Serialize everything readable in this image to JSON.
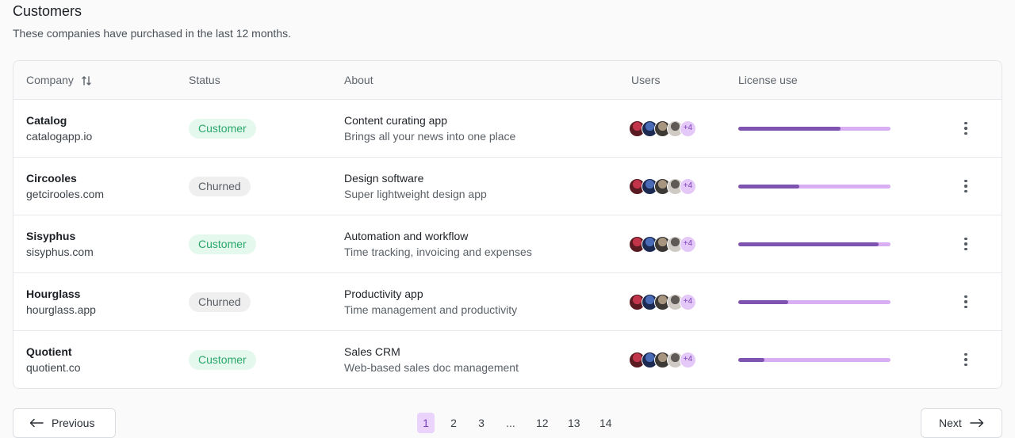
{
  "header": {
    "title": "Customers",
    "subtitle": "These companies have purchased in the last 12 months."
  },
  "table": {
    "columns": {
      "company": "Company",
      "status": "Status",
      "about": "About",
      "users": "Users",
      "license": "License use"
    },
    "rows": [
      {
        "name": "Catalog",
        "domain": "catalogapp.io",
        "status": "Customer",
        "status_type": "customer",
        "about_title": "Content curating app",
        "about_desc": "Brings all your news into one place",
        "users_more": "+4",
        "license_use": 0.67
      },
      {
        "name": "Circooles",
        "domain": "getcirooles.com",
        "status": "Churned",
        "status_type": "churned",
        "about_title": "Design software",
        "about_desc": "Super lightweight design app",
        "users_more": "+4",
        "license_use": 0.4
      },
      {
        "name": "Sisyphus",
        "domain": "sisyphus.com",
        "status": "Customer",
        "status_type": "customer",
        "about_title": "Automation and workflow",
        "about_desc": "Time tracking, invoicing and expenses",
        "users_more": "+4",
        "license_use": 0.92
      },
      {
        "name": "Hourglass",
        "domain": "hourglass.app",
        "status": "Churned",
        "status_type": "churned",
        "about_title": "Productivity app",
        "about_desc": "Time management and productivity",
        "users_more": "+4",
        "license_use": 0.33
      },
      {
        "name": "Quotient",
        "domain": "quotient.co",
        "status": "Customer",
        "status_type": "customer",
        "about_title": "Sales CRM",
        "about_desc": "Web-based sales doc management",
        "users_more": "+4",
        "license_use": 0.17
      }
    ]
  },
  "pagination": {
    "previous": "Previous",
    "next": "Next",
    "pages": [
      "1",
      "2",
      "3",
      "...",
      "12",
      "13",
      "14"
    ],
    "current": "1"
  },
  "colors": {
    "accent": "#7f53b0",
    "accent_light": "#d9aef3",
    "customer_badge_bg": "#e5f8ee",
    "customer_badge_text": "#2aa76a",
    "churned_badge_bg": "#efefef"
  },
  "icons": {
    "sort": "sort-arrows-icon",
    "more": "more-vertical-icon",
    "prev": "arrow-left-icon",
    "next": "arrow-right-icon"
  }
}
